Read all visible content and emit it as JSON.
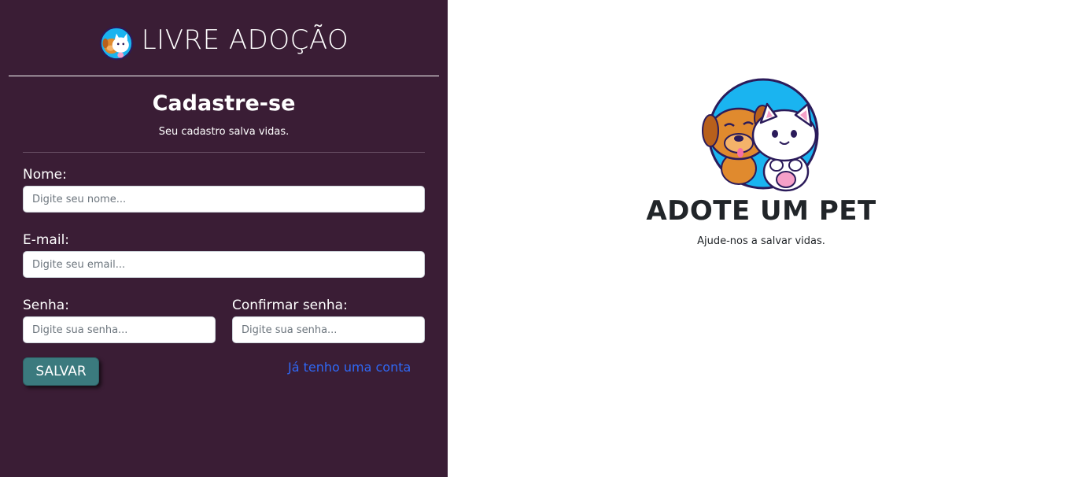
{
  "brand": {
    "title": "LIVRE ADOÇÃO",
    "logo_icon": "dog-cat-logo-icon"
  },
  "form": {
    "heading": "Cadastre-se",
    "subheading": "Seu cadastro salva vidas.",
    "name_label": "Nome:",
    "name_placeholder": "Digite seu nome...",
    "email_label": "E-mail:",
    "email_placeholder": "Digite seu email...",
    "password_label": "Senha:",
    "password_placeholder": "Digite sua senha...",
    "confirm_label": "Confirmar senha:",
    "confirm_placeholder": "Digite sua senha...",
    "save_label": "SALVAR",
    "login_link": "Já tenho uma conta"
  },
  "hero": {
    "title": "ADOTE UM PET",
    "subtitle": "Ajude-nos a salvar vidas.",
    "image_icon": "dog-cat-illustration-icon"
  },
  "colors": {
    "sidebar_bg": "#3a1d35",
    "save_button": "#3b7a7e",
    "link": "#2f68f5",
    "illustration_circle": "#1ab4f0"
  }
}
